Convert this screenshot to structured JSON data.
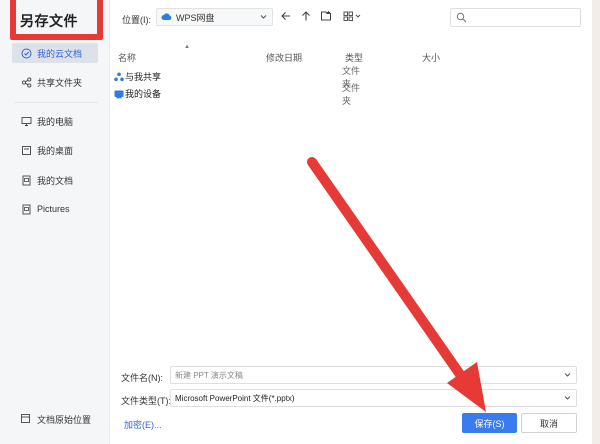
{
  "dialog": {
    "title": "另存文件"
  },
  "sidebar": {
    "items": [
      {
        "label": "我的云文档",
        "icon": "cloud-doc-icon",
        "active": true
      },
      {
        "label": "共享文件夹",
        "icon": "share-icon",
        "active": false
      },
      {
        "label": "我的电脑",
        "icon": "monitor-icon",
        "active": false
      },
      {
        "label": "我的桌面",
        "icon": "desktop-icon",
        "active": false
      },
      {
        "label": "我的文档",
        "icon": "document-icon",
        "active": false
      },
      {
        "label": "Pictures",
        "icon": "pictures-icon",
        "active": false
      }
    ],
    "bottom_label": "文档原始位置"
  },
  "location": {
    "label": "位置(I):",
    "value": "WPS网盘"
  },
  "search": {
    "placeholder": ""
  },
  "columns": {
    "name": "名称",
    "modified": "修改日期",
    "type": "类型",
    "size": "大小"
  },
  "files": [
    {
      "name": "与我共享",
      "type": "文件夹",
      "icon": "shared-folder-icon"
    },
    {
      "name": "我的设备",
      "type": "文件夹",
      "icon": "device-folder-icon"
    }
  ],
  "form": {
    "filename_label": "文件名(N):",
    "filename_value": "新建 PPT 演示文稿",
    "filetype_label": "文件类型(T):",
    "filetype_value": "Microsoft PowerPoint 文件(*.pptx)",
    "encrypt_label": "加密(E)...",
    "save_label": "保存(S)",
    "cancel_label": "取消"
  },
  "colors": {
    "accent": "#3b7bf0",
    "annotation": "#e53a35",
    "cloud": "#2f7de1"
  }
}
